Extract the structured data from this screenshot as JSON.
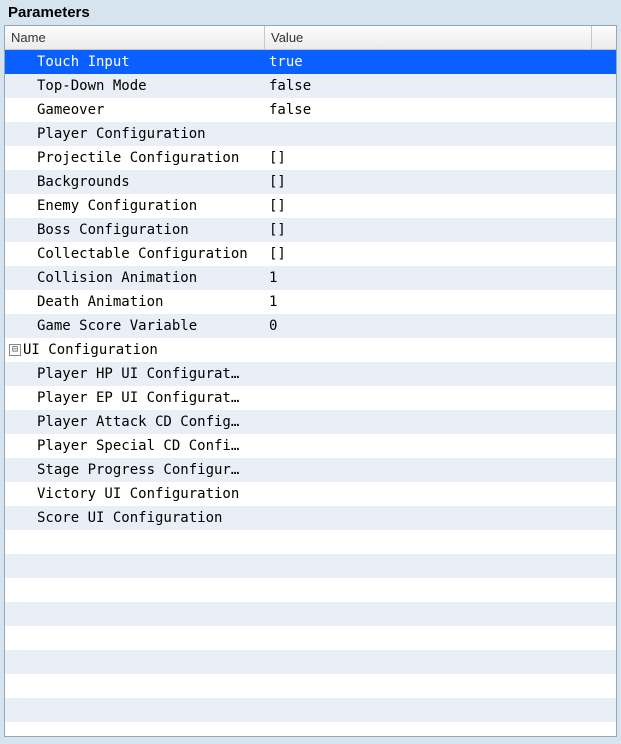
{
  "panel": {
    "title": "Parameters"
  },
  "columns": {
    "name": "Name",
    "value": "Value"
  },
  "rows": [
    {
      "indent": 1,
      "expander": "none",
      "name": "Touch Input",
      "value": "true",
      "selected": true
    },
    {
      "indent": 1,
      "expander": "none",
      "name": "Top-Down Mode",
      "value": "false"
    },
    {
      "indent": 1,
      "expander": "none",
      "name": "Gameover",
      "value": "false"
    },
    {
      "indent": 1,
      "expander": "none",
      "name": "Player Configuration",
      "value": ""
    },
    {
      "indent": 1,
      "expander": "none",
      "name": "Projectile Configuration",
      "value": "[]"
    },
    {
      "indent": 1,
      "expander": "none",
      "name": "Backgrounds",
      "value": "[]"
    },
    {
      "indent": 1,
      "expander": "none",
      "name": "Enemy Configuration",
      "value": "[]"
    },
    {
      "indent": 1,
      "expander": "none",
      "name": "Boss Configuration",
      "value": "[]"
    },
    {
      "indent": 1,
      "expander": "none",
      "name": "Collectable Configuration",
      "value": "[]"
    },
    {
      "indent": 1,
      "expander": "none",
      "name": "Collision Animation",
      "value": "1"
    },
    {
      "indent": 1,
      "expander": "none",
      "name": "Death Animation",
      "value": "1"
    },
    {
      "indent": 1,
      "expander": "none",
      "name": "Game Score Variable",
      "value": "0"
    },
    {
      "indent": 0,
      "expander": "minus",
      "name": "UI Configuration",
      "value": ""
    },
    {
      "indent": 1,
      "expander": "none",
      "name": "Player HP UI Configurat…",
      "value": ""
    },
    {
      "indent": 1,
      "expander": "none",
      "name": "Player EP UI Configurat…",
      "value": ""
    },
    {
      "indent": 1,
      "expander": "none",
      "name": "Player Attack CD Config…",
      "value": ""
    },
    {
      "indent": 1,
      "expander": "none",
      "name": "Player Special CD Confi…",
      "value": ""
    },
    {
      "indent": 1,
      "expander": "none",
      "name": "Stage Progress Configur…",
      "value": ""
    },
    {
      "indent": 1,
      "expander": "none",
      "name": "Victory UI Configuration",
      "value": ""
    },
    {
      "indent": 1,
      "expander": "none",
      "name": "Score UI Configuration",
      "value": ""
    }
  ],
  "blankRowsToFill": 8,
  "icons": {
    "collapse": "⊟",
    "expand": "⊞"
  }
}
